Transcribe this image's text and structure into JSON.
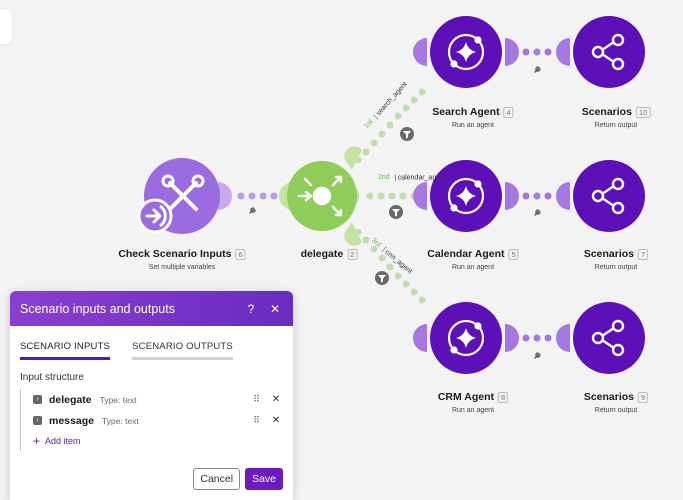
{
  "nodes": {
    "check": {
      "title": "Check Scenario Inputs",
      "badge": "6",
      "subtitle": "Set multiple variables"
    },
    "delegate": {
      "title": "delegate",
      "badge": "2",
      "subtitle": ""
    },
    "search_agent": {
      "title": "Search Agent",
      "badge": "4",
      "subtitle": "Run an agent"
    },
    "calendar_agent": {
      "title": "Calendar Agent",
      "badge": "5",
      "subtitle": "Run an agent"
    },
    "crm_agent": {
      "title": "CRM Agent",
      "badge": "8",
      "subtitle": "Run an agent"
    },
    "scenarios_top": {
      "title": "Scenarios",
      "badge": "10",
      "subtitle": "Return output"
    },
    "scenarios_mid": {
      "title": "Scenarios",
      "badge": "7",
      "subtitle": "Return output"
    },
    "scenarios_bot": {
      "title": "Scenarios",
      "badge": "9",
      "subtitle": "Return output"
    }
  },
  "routes": {
    "r1": {
      "order": "1st",
      "name": "search_agent"
    },
    "r2": {
      "order": "2nd",
      "name": "calendar_agent"
    },
    "r3": {
      "order": "3rd",
      "name": "crm_agent"
    }
  },
  "panel": {
    "title": "Scenario inputs and outputs",
    "help": "?",
    "close": "✕",
    "tabs": [
      {
        "label": "SCENARIO INPUTS"
      },
      {
        "label": "SCENARIO OUTPUTS"
      }
    ],
    "section_label": "Input structure",
    "items": [
      {
        "name": "delegate",
        "type": "Type: text"
      },
      {
        "name": "message",
        "type": "Type: text"
      }
    ],
    "add_item": "Add item",
    "cancel": "Cancel",
    "save": "Save"
  },
  "colors": {
    "purple": "#5e10b8",
    "purple_light": "#9b6be0",
    "green": "#8fcc5a",
    "green_light": "#c2e3a3",
    "connector_purple": "#a478e0"
  },
  "icons": [
    "wrench-icon",
    "arrow-in-icon",
    "router-icon",
    "agent-sparkle-icon",
    "share-icon",
    "filter-icon",
    "wrench-small-icon"
  ]
}
